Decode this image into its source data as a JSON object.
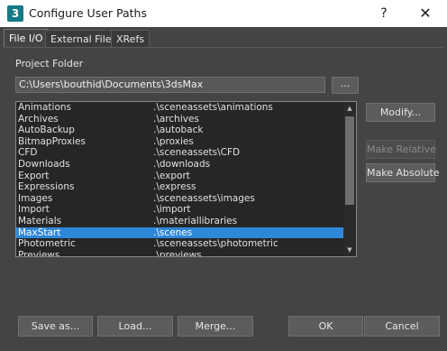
{
  "window": {
    "title": "Configure User Paths",
    "app_icon_glyph": "3",
    "help_glyph": "?",
    "close_glyph": "✕"
  },
  "tabs": [
    {
      "label": "File I/O",
      "active": true
    },
    {
      "label": "External Files",
      "active": false
    },
    {
      "label": "XRefs",
      "active": false
    }
  ],
  "project": {
    "label": "Project Folder",
    "path": "C:\\Users\\bouthid\\Documents\\3dsMax",
    "browse_label": "..."
  },
  "paths": [
    {
      "name": "Animations",
      "value": ".\\sceneassets\\animations"
    },
    {
      "name": "Archives",
      "value": ".\\archives"
    },
    {
      "name": "AutoBackup",
      "value": ".\\autoback"
    },
    {
      "name": "BitmapProxies",
      "value": ".\\proxies"
    },
    {
      "name": "CFD",
      "value": ".\\sceneassets\\CFD"
    },
    {
      "name": "Downloads",
      "value": ".\\downloads"
    },
    {
      "name": "Export",
      "value": ".\\export"
    },
    {
      "name": "Expressions",
      "value": ".\\express"
    },
    {
      "name": "Images",
      "value": ".\\sceneassets\\images"
    },
    {
      "name": "Import",
      "value": ".\\import"
    },
    {
      "name": "Materials",
      "value": ".\\materiallibraries"
    },
    {
      "name": "MaxStart",
      "value": ".\\scenes",
      "selected": true
    },
    {
      "name": "Photometric",
      "value": ".\\sceneassets\\photometric"
    },
    {
      "name": "Previews",
      "value": ".\\previews"
    }
  ],
  "side_buttons": {
    "modify": "Modify...",
    "make_relative": "Make Relative",
    "make_absolute": "Make Absolute"
  },
  "bottom_buttons": {
    "save_as": "Save as...",
    "load": "Load...",
    "merge": "Merge...",
    "ok": "OK",
    "cancel": "Cancel"
  },
  "colors": {
    "background": "#444444",
    "selection": "#2f87d8",
    "list_background": "#262626"
  }
}
